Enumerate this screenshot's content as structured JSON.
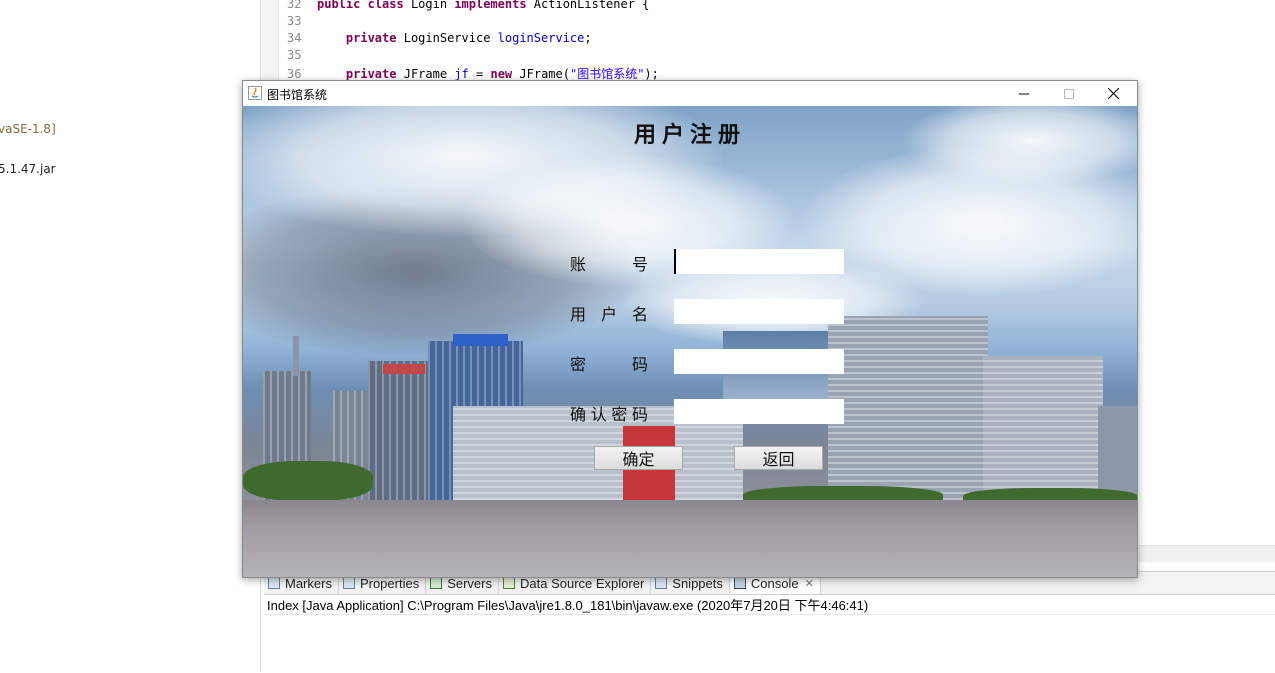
{
  "explorer": {
    "jre_item": "vaSE-1.8]",
    "jar_item": "5.1.47.jar"
  },
  "editor": {
    "lines": [
      {
        "n": "32"
      },
      {
        "n": "33"
      },
      {
        "n": "34"
      },
      {
        "n": "35"
      },
      {
        "n": "36"
      }
    ],
    "tokens": {
      "public": "public",
      "class": "class",
      "Login": "Login",
      "implements": "implements",
      "ActionListener": "ActionListener {",
      "private": "private",
      "LoginService": "LoginService",
      "loginService": "loginService",
      "semi": ";",
      "JFrame": "JFrame",
      "jf": "jf",
      "eq": "=",
      "new": "new",
      "JFrameCall": "JFrame(",
      "frameTitle": "\"图书馆系统\"",
      "close": ");"
    }
  },
  "bottom_panel": {
    "tabs": [
      {
        "label": "Markers",
        "icon": "markers-icon"
      },
      {
        "label": "Properties",
        "icon": "properties-icon"
      },
      {
        "label": "Servers",
        "icon": "servers-icon"
      },
      {
        "label": "Data Source Explorer",
        "icon": "data-source-icon"
      },
      {
        "label": "Snippets",
        "icon": "snippets-icon"
      },
      {
        "label": "Console",
        "icon": "console-icon",
        "close": "✕"
      }
    ],
    "console_status": "Index [Java Application] C:\\Program Files\\Java\\jre1.8.0_181\\bin\\javaw.exe (2020年7月20日 下午4:46:41)"
  },
  "window": {
    "title": "图书馆系统",
    "minimize": "—",
    "maximize": "☐",
    "close": "✕",
    "colors": {
      "accent_text": "#111111",
      "title_bar": "#ffffff"
    }
  },
  "form": {
    "heading": "用户注册",
    "fields": [
      {
        "label": [
          "账",
          "号"
        ],
        "value": ""
      },
      {
        "label": [
          "用",
          "户",
          "名"
        ],
        "value": ""
      },
      {
        "label": [
          "密",
          "码"
        ],
        "value": ""
      },
      {
        "label": [
          "确",
          "认",
          "密",
          "码"
        ],
        "value": ""
      }
    ],
    "confirm_label": "确定",
    "back_label": "返回"
  }
}
